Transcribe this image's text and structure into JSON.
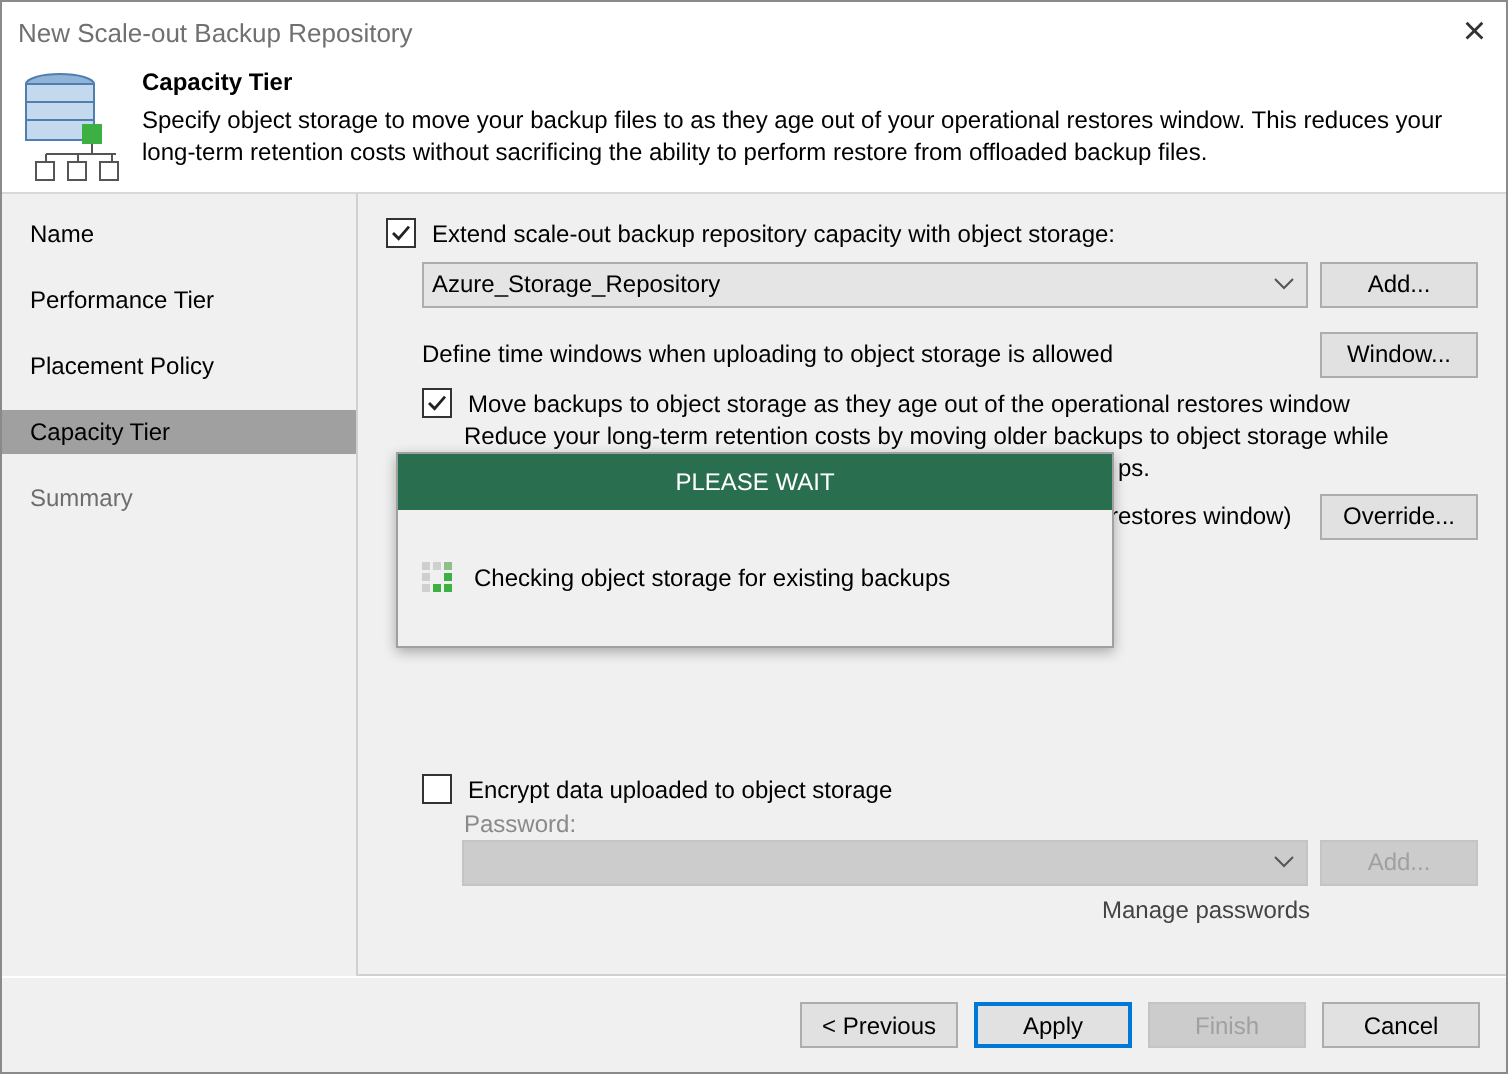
{
  "window": {
    "title": "New Scale-out Backup Repository",
    "close": "×"
  },
  "header": {
    "title": "Capacity Tier",
    "description": "Specify object storage to move your backup files to as they age out of your operational restores window. This reduces your long-term retention costs without sacrificing the ability to perform restore from offloaded backup files."
  },
  "steps": [
    {
      "label": "Name",
      "selected": false,
      "disabled": false
    },
    {
      "label": "Performance Tier",
      "selected": false,
      "disabled": false
    },
    {
      "label": "Placement Policy",
      "selected": false,
      "disabled": false
    },
    {
      "label": "Capacity Tier",
      "selected": true,
      "disabled": false
    },
    {
      "label": "Summary",
      "selected": false,
      "disabled": true
    }
  ],
  "extend": {
    "label": "Extend scale-out backup repository capacity with object storage:",
    "checked": true
  },
  "repository": {
    "value": "Azure_Storage_Repository",
    "button": "Add..."
  },
  "time_window": {
    "label": "Define time windows when uploading to object storage is allowed",
    "button": "Window..."
  },
  "move": {
    "label": "Move backups to object storage as they age out of the operational restores window",
    "checked": true,
    "description": "Reduce your long-term retention costs by moving older backups to object storage while",
    "description_tail": "ps.",
    "override_tail": "restores window)",
    "button": "Override..."
  },
  "encrypt": {
    "label": "Encrypt data uploaded to object storage",
    "checked": false,
    "password_label": "Password:",
    "button": "Add...",
    "link": "Manage passwords"
  },
  "progress_dialog": {
    "title": "PLEASE WAIT",
    "message": "Checking object storage for existing backups"
  },
  "buttons": [
    {
      "label": "< Previous",
      "disabled": false,
      "focused": false
    },
    {
      "label": "Apply",
      "disabled": false,
      "focused": true
    },
    {
      "label": "Finish",
      "disabled": true,
      "focused": false
    },
    {
      "label": "Cancel",
      "disabled": false,
      "focused": false
    }
  ]
}
